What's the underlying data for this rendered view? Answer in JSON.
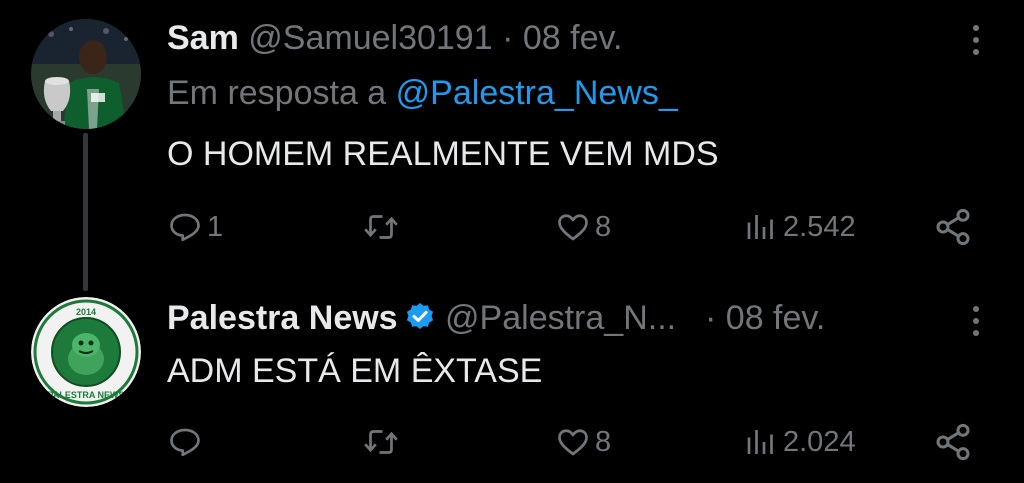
{
  "tweets": [
    {
      "display_name": "Sam",
      "handle": "@Samuel30191",
      "dot": "·",
      "time": "08 fev.",
      "reply_prefix": "Em resposta a",
      "reply_handle": "@Palestra_News_",
      "text": "O HOMEM REALMENTE VEM MDS",
      "replies": "1",
      "retweets": "",
      "likes": "8",
      "views": "2.542",
      "verified": false
    },
    {
      "display_name": "Palestra News",
      "handle": "@Palestra_N...",
      "dot": "·",
      "time": "08 fev.",
      "text": "ADM ESTÁ EM ÊXTASE",
      "replies": "",
      "retweets": "",
      "likes": "8",
      "views": "2.024",
      "verified": true,
      "logo_text_top": "2014",
      "logo_text_bottom": "PALESTRA NEWS"
    }
  ],
  "colors": {
    "background": "#000000",
    "text": "#e7e9ea",
    "secondary": "#71767b",
    "link": "#1d9bf0",
    "verified": "#1d9bf0",
    "logo_green": "#1e7a3a"
  },
  "icons": [
    "reply-icon",
    "retweet-icon",
    "like-icon",
    "views-icon",
    "share-icon",
    "more-icon",
    "verified-badge-icon"
  ]
}
